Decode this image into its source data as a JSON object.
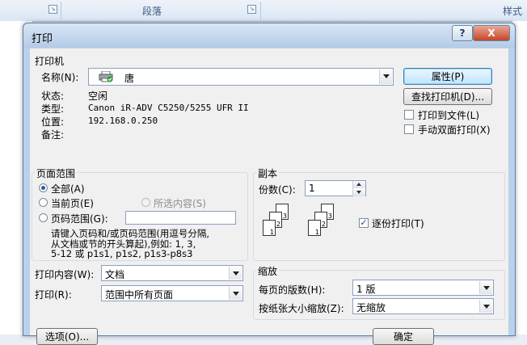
{
  "ribbon": {
    "group_paragraph": "段落",
    "group_styles": "样式"
  },
  "dialog": {
    "title": "打印",
    "help": "?",
    "close": "X",
    "printer": {
      "group": "打印机",
      "name_label": "名称(N):",
      "name_value": "唐",
      "status_label": "状态:",
      "status_value": "空闲",
      "type_label": "类型:",
      "type_value": "Canon iR-ADV C5250/5255 UFR II",
      "where_label": "位置:",
      "where_value": "192.168.0.250",
      "comment_label": "备注:",
      "properties_btn": "属性(P)",
      "find_printer_btn": "查找打印机(D)...",
      "print_to_file": "打印到文件(L)",
      "manual_duplex": "手动双面打印(X)"
    },
    "page_range": {
      "group": "页面范围",
      "all": "全部(A)",
      "current": "当前页(E)",
      "selection": "所选内容(S)",
      "pages": "页码范围(G):",
      "pages_value": "",
      "hint_line1": "请键入页码和/或页码范围(用逗号分隔,",
      "hint_line2": "从文档或节的开头算起),例如: 1, 3,",
      "hint_line3": "5-12 或 p1s1, p1s2, p1s3-p8s3"
    },
    "copies": {
      "group": "副本",
      "count_label": "份数(C):",
      "count_value": "1",
      "collate": "逐份打印(T)"
    },
    "print_what": {
      "label": "打印内容(W):",
      "value": "文档"
    },
    "print": {
      "label": "打印(R):",
      "value": "范围中所有页面"
    },
    "zoom": {
      "group": "缩放",
      "pages_per_sheet_label": "每页的版数(H):",
      "pages_per_sheet_value": "1 版",
      "scale_label": "按纸张大小缩放(Z):",
      "scale_value": "无缩放"
    },
    "options_btn": "选项(O)...",
    "ok_btn": "确定"
  }
}
